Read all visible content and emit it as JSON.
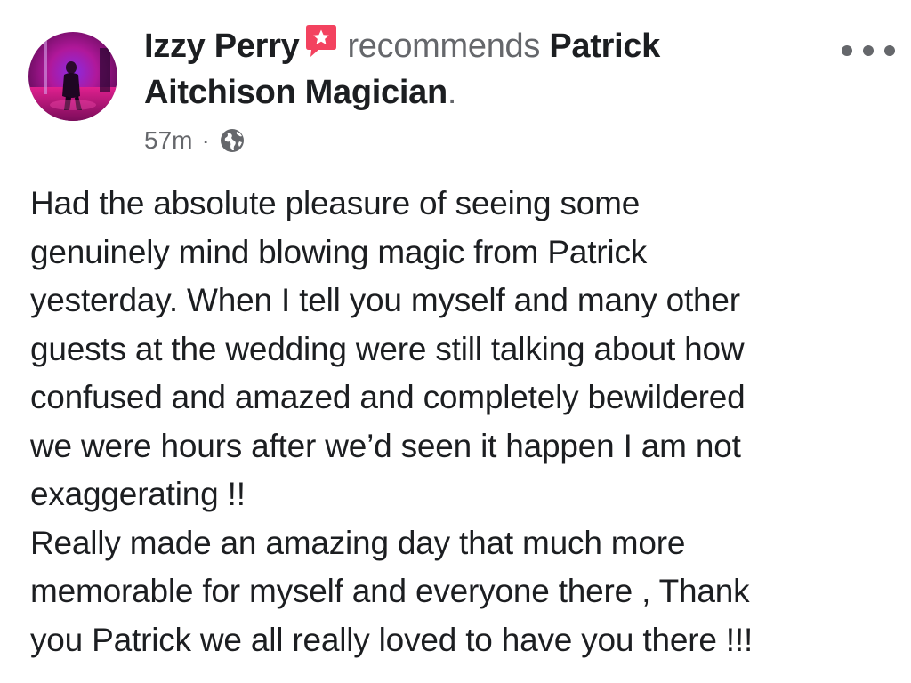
{
  "post": {
    "author": "Izzy Perry",
    "action": "recommends",
    "page_name": "Patrick Aitchison Magician",
    "page_name_line1": "Patrick",
    "page_name_line2": "Aitchison Magician",
    "period": ".",
    "timestamp": "57m",
    "separator": "·",
    "privacy_icon": "globe-icon",
    "recommend_icon": "recommend-star-icon",
    "more_icon": "more-options-icon",
    "body_lines": [
      "Had the absolute pleasure of seeing some",
      "genuinely mind blowing magic from Patrick",
      "yesterday. When I tell you myself and many other",
      "guests at the wedding were still talking about how",
      "confused and amazed and completely bewildered",
      "we were hours after we’d seen it happen I am not",
      "exaggerating !!",
      "Really made an amazing day that much more",
      "memorable for myself and everyone there , Thank",
      "you Patrick we all really loved to have you there !!!"
    ]
  },
  "colors": {
    "text_primary": "#1c1e21",
    "text_secondary": "#65676b",
    "recommend_red": "#f3425f",
    "avatar_magenta": "#c0188f"
  }
}
